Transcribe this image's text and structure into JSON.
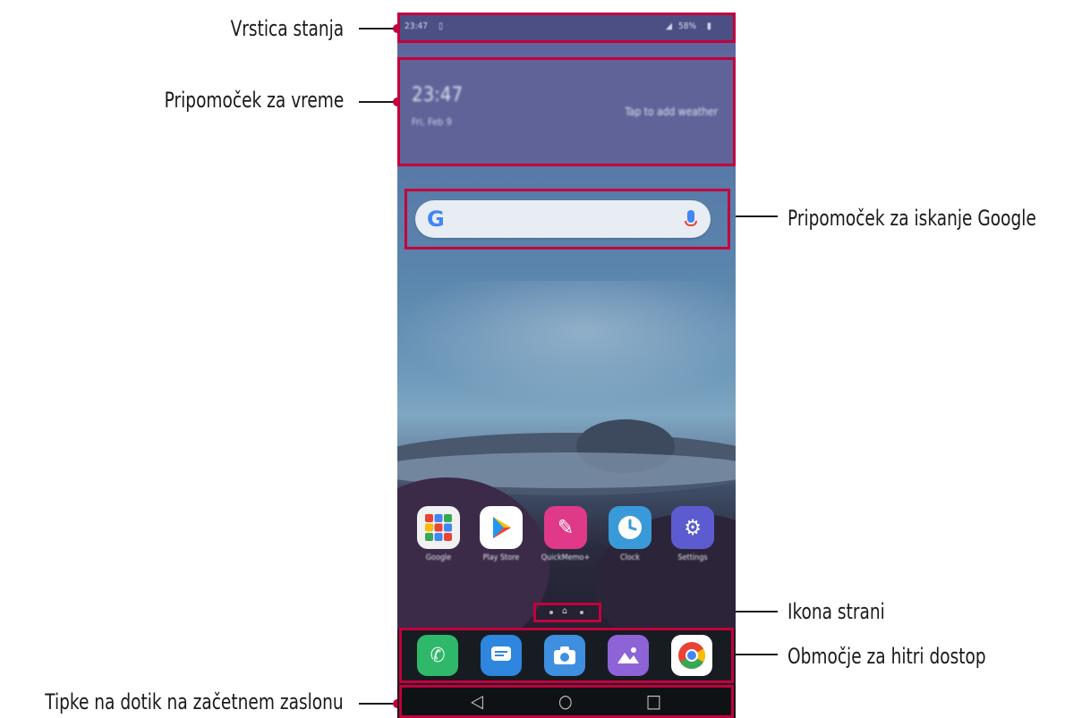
{
  "annotations": {
    "status_bar": "Vrstica stanja",
    "weather_widget": "Pripomoček za vreme",
    "google_search_widget": "Pripomoček za iskanje Google",
    "page_icon": "Ikona strani",
    "quick_access_area": "Območje za hitri dostop",
    "home_touch_keys": "Tipke na dotik na začetnem zaslonu"
  },
  "phone": {
    "status": {
      "time": "23:47",
      "battery": "58%"
    },
    "weather": {
      "time": "23:47",
      "date": "Fri, Feb 9",
      "tap": "Tap to add weather"
    },
    "apps": [
      {
        "label": "Google",
        "icon": "google-folder-icon",
        "color": "#f1f1f1"
      },
      {
        "label": "Play Store",
        "icon": "play-store-icon",
        "color": "#ffffff"
      },
      {
        "label": "QuickMemo+",
        "icon": "quickmemo-icon",
        "color": "#e0398a"
      },
      {
        "label": "Clock",
        "icon": "clock-icon",
        "color": "#3a9ad9"
      },
      {
        "label": "Settings",
        "icon": "settings-icon",
        "color": "#5d5bd0"
      }
    ],
    "dock": [
      {
        "icon": "phone-icon",
        "color": "#2fb86a"
      },
      {
        "icon": "messages-icon",
        "color": "#2e86de"
      },
      {
        "icon": "camera-icon",
        "color": "#3f8fe0"
      },
      {
        "icon": "gallery-icon",
        "color": "#8e63d8"
      },
      {
        "icon": "chrome-icon",
        "color": "#ffffff"
      }
    ],
    "nav": {
      "back": "◁",
      "home": "○",
      "recents": "□"
    }
  },
  "colors": {
    "accent": "#c4003c"
  }
}
